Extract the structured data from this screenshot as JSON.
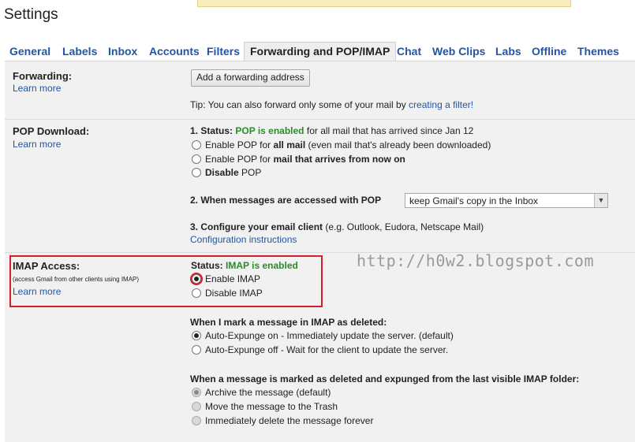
{
  "page": {
    "title": "Settings"
  },
  "tabs": [
    {
      "label": "General"
    },
    {
      "label": "Labels"
    },
    {
      "label": "Inbox"
    },
    {
      "label": "Accounts"
    },
    {
      "label": "Filters"
    },
    {
      "label": "Forwarding and POP/IMAP"
    },
    {
      "label": "Chat"
    },
    {
      "label": "Web Clips"
    },
    {
      "label": "Labs"
    },
    {
      "label": "Offline"
    },
    {
      "label": "Themes"
    }
  ],
  "forwarding": {
    "label": "Forwarding:",
    "learn_more": "Learn more",
    "add_button": "Add a forwarding address",
    "tip_text": "Tip: You can also forward only some of your mail by",
    "tip_link": "creating a filter!"
  },
  "pop": {
    "label": "POP Download:",
    "learn_more": "Learn more",
    "status_prefix": "1. Status:",
    "status_value": "POP is enabled",
    "status_suffix": "for all mail that has arrived since Jan 12",
    "opt1_pre": "Enable POP for",
    "opt1_bold": "all mail",
    "opt1_post": "(even mail that's already been downloaded)",
    "opt2_pre": "Enable POP for",
    "opt2_bold": "mail that arrives from now on",
    "opt3_bold": "Disable",
    "opt3_post": "POP",
    "access_label": "2. When messages are accessed with POP",
    "access_value": "keep Gmail's copy in the Inbox",
    "configure_bold": "3. Configure your email client",
    "configure_rest": "(e.g. Outlook, Eudora, Netscape Mail)",
    "configure_link": "Configuration instructions"
  },
  "imap": {
    "label": "IMAP Access:",
    "sublabel": "(access Gmail from other clients using IMAP)",
    "learn_more": "Learn more",
    "status_prefix": "Status:",
    "status_value": "IMAP is enabled",
    "enable": "Enable IMAP",
    "disable": "Disable IMAP",
    "deleted_heading": "When I mark a message in IMAP as deleted:",
    "del_opt1": "Auto-Expunge on - Immediately update the server. (default)",
    "del_opt2": "Auto-Expunge off - Wait for the client to update the server.",
    "expunged_heading": "When a message is marked as deleted and expunged from the last visible IMAP folder:",
    "exp_opt1": "Archive the message (default)",
    "exp_opt2": "Move the message to the Trash",
    "exp_opt3": "Immediately delete the message forever"
  },
  "watermark": "http://h0w2.blogspot.com",
  "colors": {
    "link": "#2155a6",
    "enabled_green": "#2b8a2b",
    "highlight_red": "#d21f2b"
  }
}
